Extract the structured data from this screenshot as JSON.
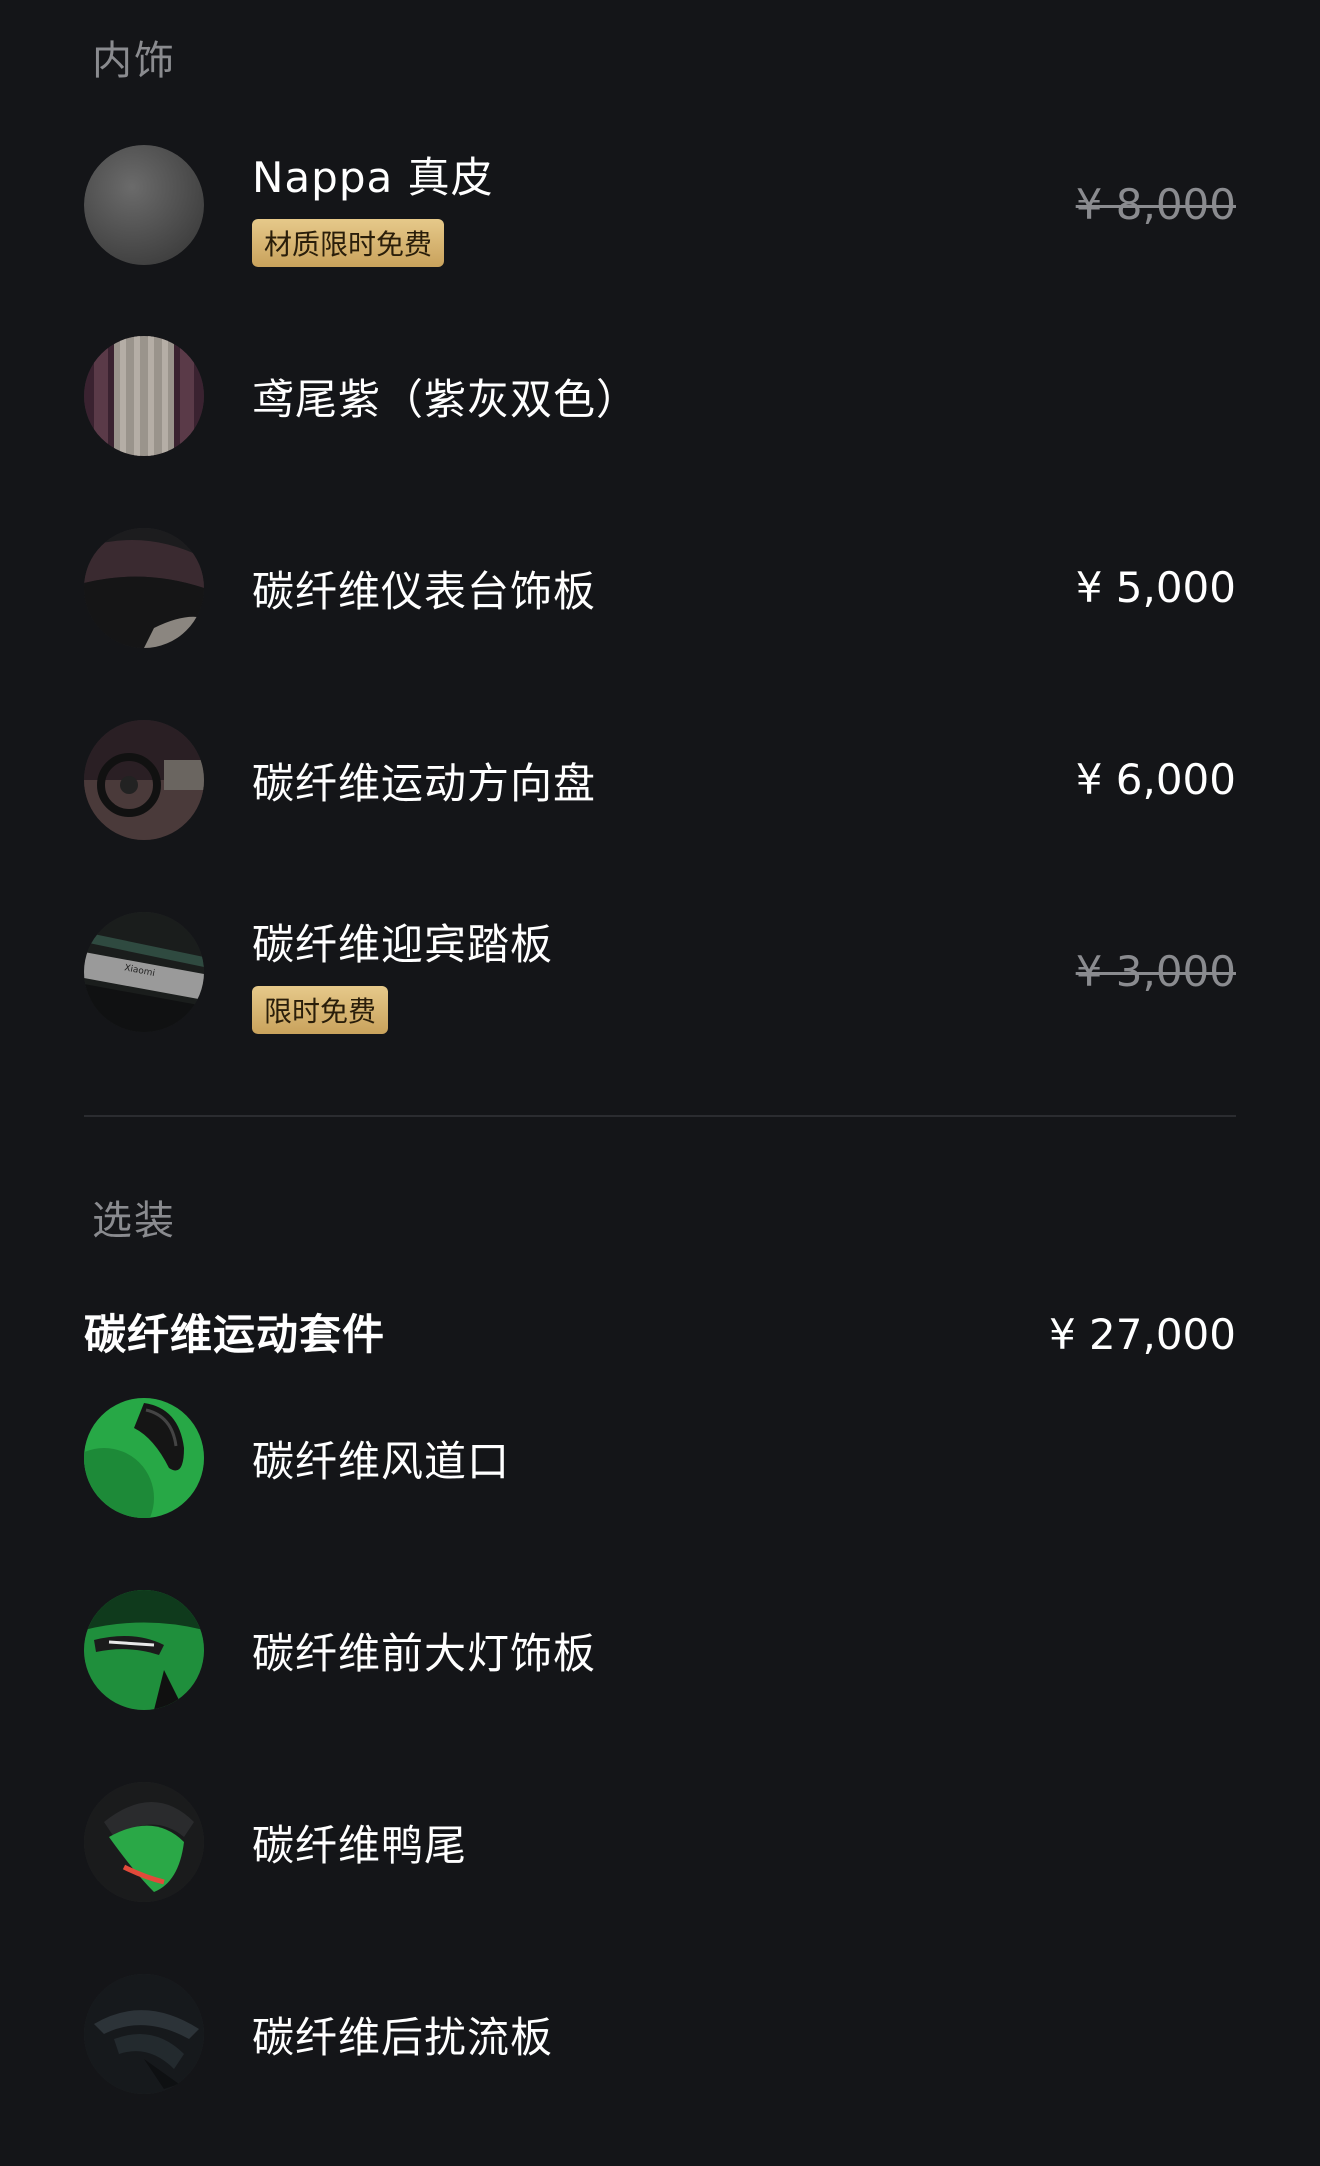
{
  "interior": {
    "header": "内饰",
    "items": [
      {
        "label": "Nappa 真皮",
        "badge": "材质限时免费",
        "price": "¥ 8,000",
        "price_struck": true,
        "icon": "nappa-leather-swatch-icon"
      },
      {
        "label": "鸢尾紫（紫灰双色）",
        "price": "",
        "icon": "iris-purple-swatch-icon"
      },
      {
        "label": "碳纤维仪表台饰板",
        "price": "¥ 5,000",
        "icon": "carbon-dashboard-trim-icon"
      },
      {
        "label": "碳纤维运动方向盘",
        "price": "¥ 6,000",
        "icon": "carbon-steering-wheel-icon"
      },
      {
        "label": "碳纤维迎宾踏板",
        "badge": "限时免费",
        "price": "¥ 3,000",
        "price_struck": true,
        "icon": "carbon-door-sill-icon",
        "thumb_text": "Xiaomi"
      }
    ]
  },
  "options": {
    "header": "选装",
    "package": {
      "title": "碳纤维运动套件",
      "price": "¥ 27,000",
      "items": [
        {
          "label": "碳纤维风道口",
          "icon": "carbon-air-duct-icon"
        },
        {
          "label": "碳纤维前大灯饰板",
          "icon": "carbon-headlight-trim-icon"
        },
        {
          "label": "碳纤维鸭尾",
          "icon": "carbon-ducktail-spoiler-icon"
        },
        {
          "label": "碳纤维后扰流板",
          "icon": "carbon-rear-spoiler-icon"
        }
      ]
    }
  },
  "colors": {
    "background": "#141518",
    "muted_text": "#8a8b8f",
    "badge_gold": "#d9b46f",
    "accent_green": "#2bb34a"
  }
}
